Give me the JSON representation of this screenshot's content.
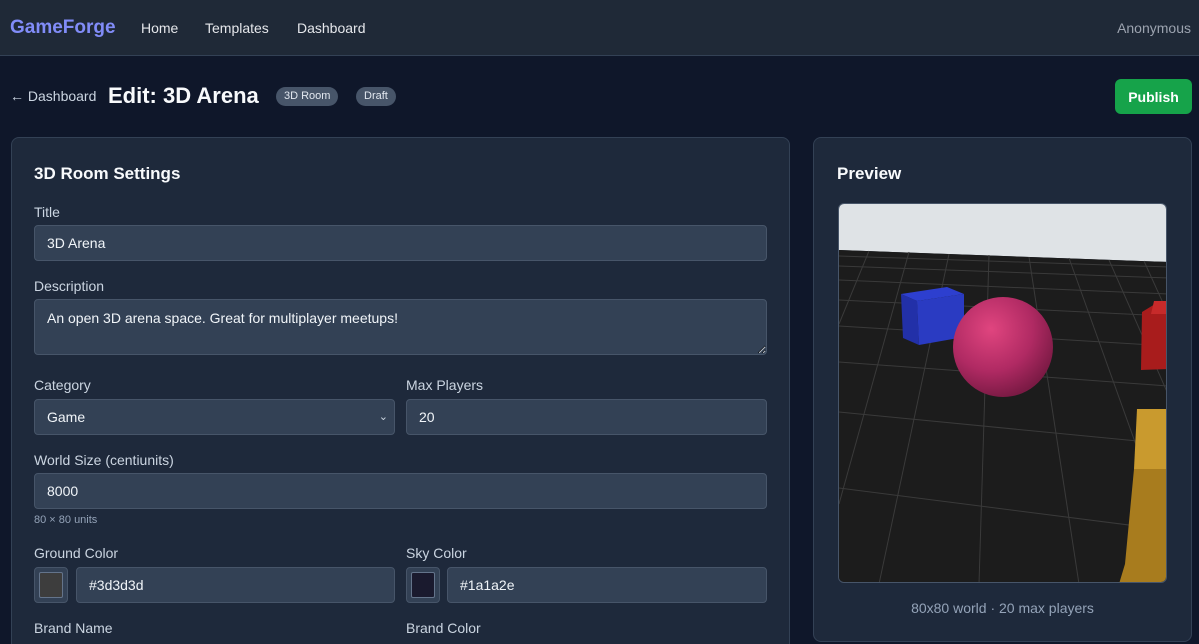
{
  "nav": {
    "brand": "GameForge",
    "links": [
      "Home",
      "Templates",
      "Dashboard"
    ],
    "user": "Anonymous"
  },
  "header": {
    "back_label": "← Dashboard",
    "title": "Edit: 3D Arena",
    "badges": [
      "3D Room",
      "Draft"
    ],
    "publish_label": "Publish"
  },
  "settings": {
    "heading": "3D Room Settings",
    "title_label": "Title",
    "title_value": "3D Arena",
    "description_label": "Description",
    "description_value": "An open 3D arena space. Great for multiplayer meetups!",
    "category_label": "Category",
    "category_value": "Game",
    "max_players_label": "Max Players",
    "max_players_value": "20",
    "world_size_label": "World Size (centiunits)",
    "world_size_value": "8000",
    "world_size_hint": "80 × 80 units",
    "ground_color_label": "Ground Color",
    "ground_color_value": "#3d3d3d",
    "sky_color_label": "Sky Color",
    "sky_color_value": "#1a1a2e",
    "brand_name_label": "Brand Name",
    "brand_color_label": "Brand Color"
  },
  "preview": {
    "heading": "Preview",
    "caption": "80x80 world · 20 max players"
  },
  "colors": {
    "accent": "#818cf8",
    "publish": "#16a34a",
    "ground_swatch": "#3d3d3d",
    "sky_swatch": "#1a1a2e"
  }
}
